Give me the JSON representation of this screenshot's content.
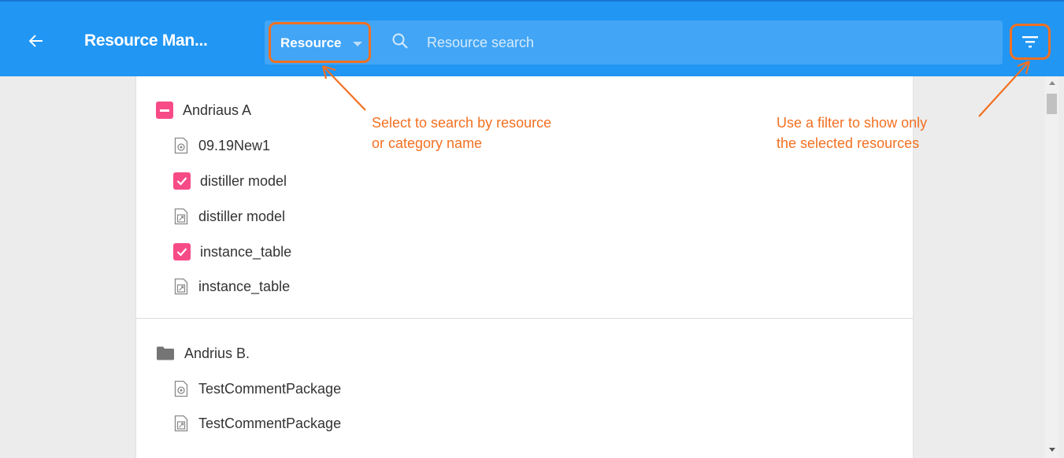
{
  "header": {
    "title": "Resource Man...",
    "scope_label": "Resource",
    "search_placeholder": "Resource search"
  },
  "groups": [
    {
      "name": "Andriaus A",
      "state": "partial",
      "items": [
        {
          "label": "09.19New1",
          "icon": "package-file-icon"
        },
        {
          "label": "distiller model",
          "icon": "checkbox-checked"
        },
        {
          "label": "distiller model",
          "icon": "model-file-icon"
        },
        {
          "label": "instance_table",
          "icon": "checkbox-checked"
        },
        {
          "label": "instance_table",
          "icon": "model-file-icon"
        }
      ]
    },
    {
      "name": "Andrius B.",
      "state": "folder",
      "items": [
        {
          "label": "TestCommentPackage",
          "icon": "package-file-icon"
        },
        {
          "label": "TestCommentPackage",
          "icon": "model-file-icon"
        }
      ]
    }
  ],
  "annotations": {
    "scope": [
      "Select to search by resource",
      "or category name"
    ],
    "filter": [
      "Use a filter to show only",
      "the selected resources"
    ]
  },
  "colors": {
    "header": "#2196f3",
    "search_bar": "#42a5f5",
    "checkbox": "#f74b87",
    "annotation": "#f37021",
    "folder": "#757575"
  }
}
